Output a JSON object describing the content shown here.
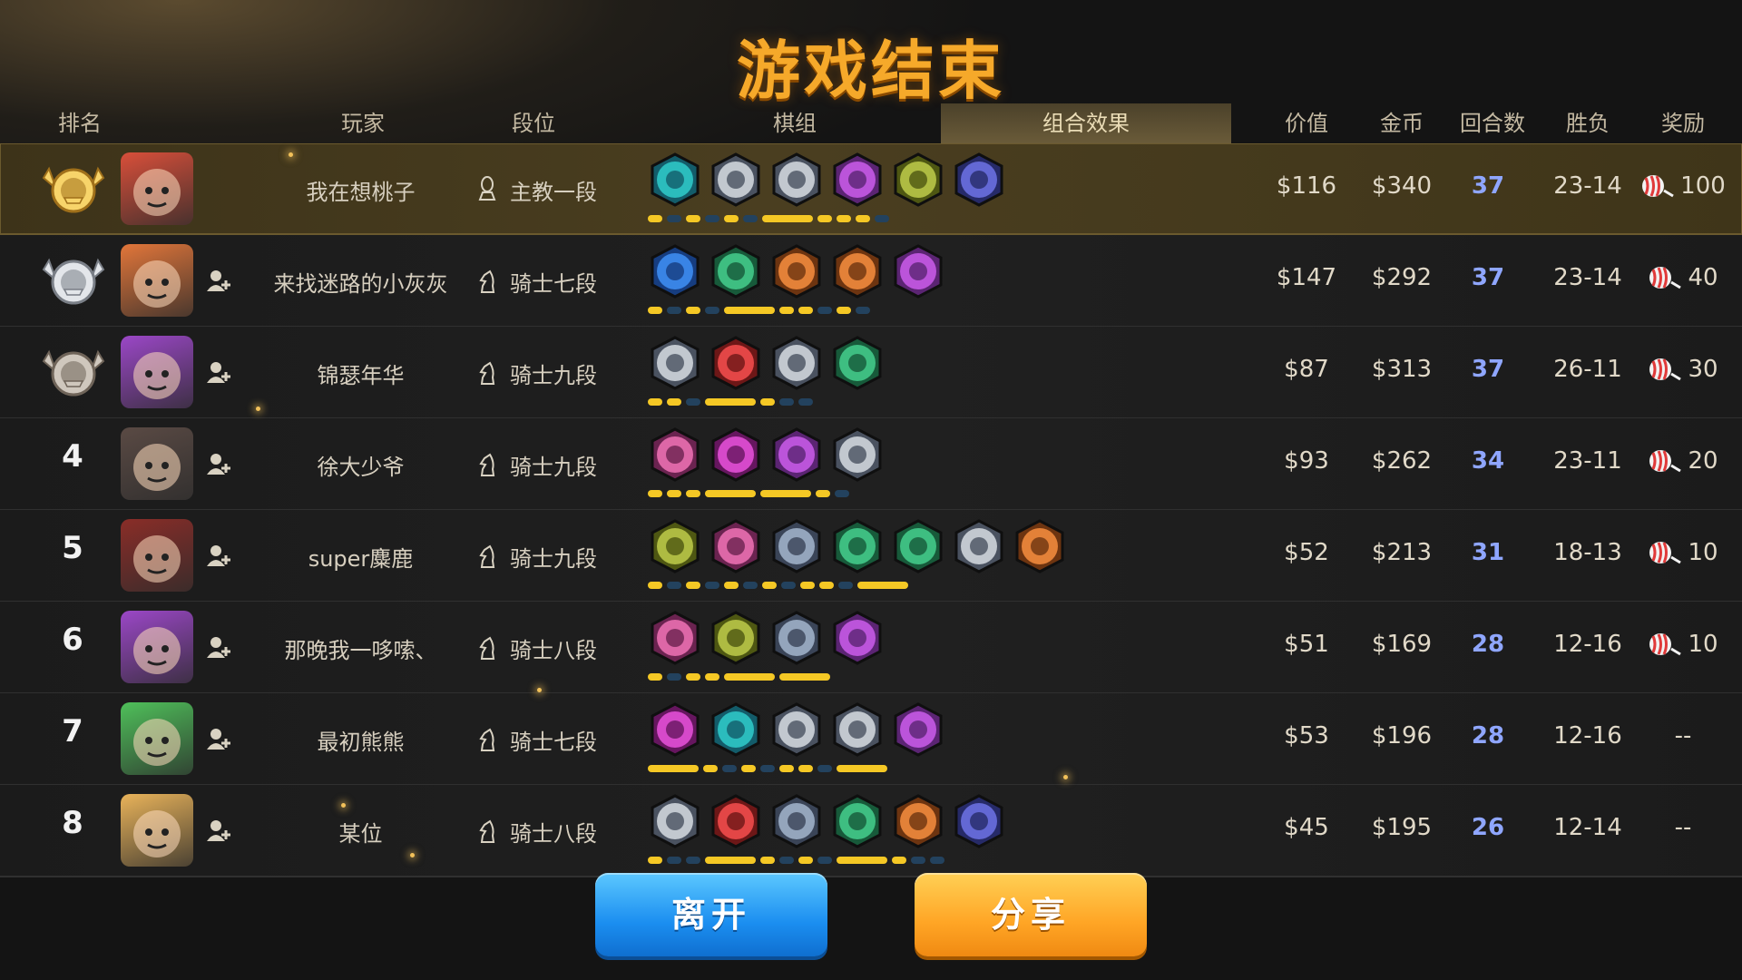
{
  "title": "游戏结束",
  "headers": {
    "rank": "排名",
    "player": "玩家",
    "tier": "段位",
    "lineup": "棋组",
    "synergy": "组合效果",
    "value": "价值",
    "gold": "金币",
    "rounds": "回合数",
    "winloss": "胜负",
    "reward": "奖励"
  },
  "players": [
    {
      "rank": "1",
      "medal": "gold",
      "avatar": "#d94f3a",
      "name": "我在想桃子",
      "tier": "主教一段",
      "value": "$116",
      "gold": "$340",
      "rounds": "37",
      "wl": "23-14",
      "reward": "100",
      "units": [
        "cyan",
        "gray",
        "gray",
        "purple",
        "olive",
        "navy"
      ],
      "bars": [
        1,
        0,
        1,
        0,
        1,
        0,
        3,
        1,
        1,
        1,
        0
      ]
    },
    {
      "rank": "2",
      "medal": "silver",
      "avatar": "#e2763a",
      "name": "来找迷路的小灰灰",
      "tier": "骑士七段",
      "value": "$147",
      "gold": "$292",
      "rounds": "37",
      "wl": "23-14",
      "reward": "40",
      "units": [
        "blue",
        "green",
        "orange",
        "orange",
        "purple"
      ],
      "bars": [
        1,
        0,
        1,
        0,
        3,
        1,
        1,
        0,
        1,
        0
      ]
    },
    {
      "rank": "3",
      "medal": "bronze",
      "avatar": "#9b47c7",
      "name": "锦瑟年华",
      "tier": "骑士九段",
      "value": "$87",
      "gold": "$313",
      "rounds": "37",
      "wl": "26-11",
      "reward": "30",
      "units": [
        "gray",
        "red",
        "gray",
        "green"
      ],
      "bars": [
        1,
        1,
        0,
        3,
        1,
        0,
        0
      ]
    },
    {
      "rank": "4",
      "medal": "",
      "avatar": "#5a4a44",
      "name": "徐大少爷",
      "tier": "骑士九段",
      "value": "$93",
      "gold": "$262",
      "rounds": "34",
      "wl": "23-11",
      "reward": "20",
      "units": [
        "pink",
        "magenta",
        "purple",
        "gray"
      ],
      "bars": [
        1,
        1,
        1,
        3,
        3,
        1,
        0
      ]
    },
    {
      "rank": "5",
      "medal": "",
      "avatar": "#8a2d28",
      "name": "super麋鹿",
      "tier": "骑士九段",
      "value": "$52",
      "gold": "$213",
      "rounds": "31",
      "wl": "18-13",
      "reward": "10",
      "units": [
        "olive",
        "pink",
        "slate",
        "green",
        "green",
        "gray",
        "orange"
      ],
      "bars": [
        1,
        0,
        1,
        0,
        1,
        0,
        1,
        0,
        1,
        1,
        0,
        3
      ]
    },
    {
      "rank": "6",
      "medal": "",
      "avatar": "#9b47c7",
      "name": "那晚我一哆嗦、",
      "tier": "骑士八段",
      "value": "$51",
      "gold": "$169",
      "rounds": "28",
      "wl": "12-16",
      "reward": "10",
      "units": [
        "pink",
        "olive",
        "slate",
        "purple"
      ],
      "bars": [
        1,
        0,
        1,
        1,
        3,
        3
      ]
    },
    {
      "rank": "7",
      "medal": "",
      "avatar": "#4fc05a",
      "name": "最初熊熊",
      "tier": "骑士七段",
      "value": "$53",
      "gold": "$196",
      "rounds": "28",
      "wl": "12-16",
      "reward": "--",
      "units": [
        "magenta",
        "cyan",
        "gray",
        "gray",
        "purple"
      ],
      "bars": [
        3,
        1,
        0,
        1,
        0,
        1,
        1,
        0,
        3
      ]
    },
    {
      "rank": "8",
      "medal": "",
      "avatar": "#e9b35a",
      "name": "某位",
      "tier": "骑士八段",
      "value": "$45",
      "gold": "$195",
      "rounds": "26",
      "wl": "12-14",
      "reward": "--",
      "units": [
        "gray",
        "red",
        "slate",
        "green",
        "orange",
        "navy"
      ],
      "bars": [
        1,
        0,
        0,
        3,
        1,
        0,
        1,
        0,
        3,
        1,
        0,
        0
      ]
    }
  ],
  "buttons": {
    "leave": "离开",
    "share": "分享"
  },
  "colors": {
    "accent_gold": "#f6a92a",
    "bar_on": "#f5c825",
    "bar_off": "#23425e",
    "rounds": "#8fa6ff"
  }
}
